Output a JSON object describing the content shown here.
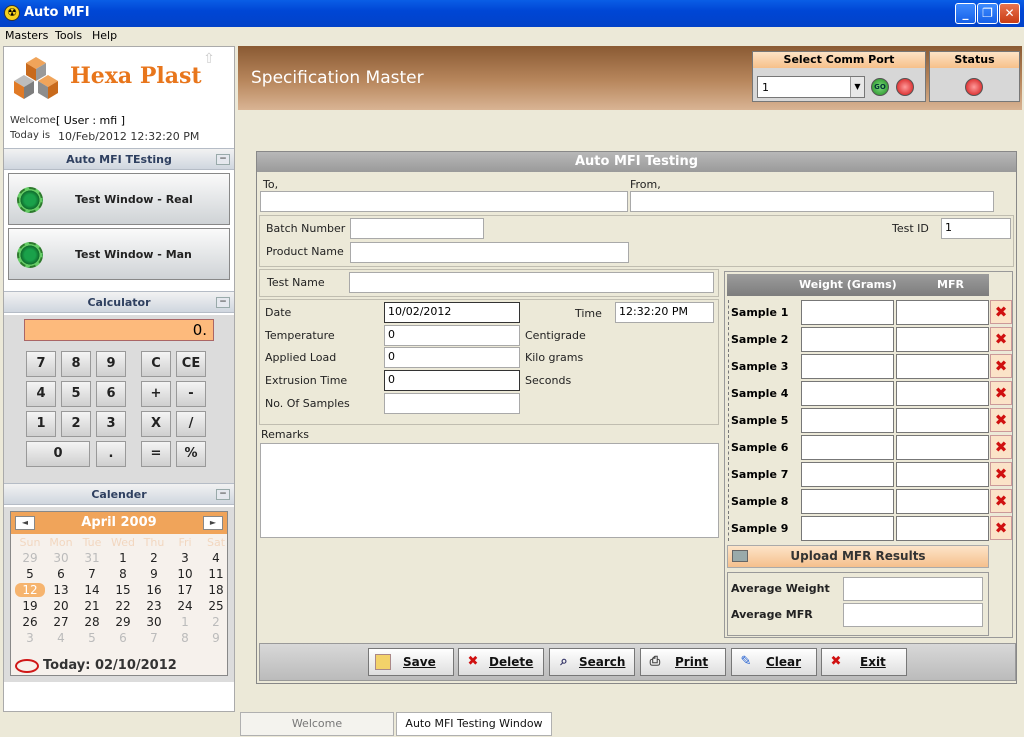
{
  "window": {
    "title": "Auto MFI"
  },
  "menu": [
    "Masters",
    "Tools",
    "Help"
  ],
  "brand": {
    "name": "Hexa Plast"
  },
  "session": {
    "welcome_label": "Welcome,",
    "user": "[ User : mfi ]",
    "today_label": "Today is",
    "today_value": "10/Feb/2012 12:32:20 PM"
  },
  "sidebar": {
    "testing_title": "Auto MFI TEsting",
    "test_real": "Test Window - Real",
    "test_man": "Test Window - Man",
    "calculator_title": "Calculator",
    "calendar_title": "Calender"
  },
  "calculator": {
    "display": "0.",
    "keys": [
      "7",
      "8",
      "9",
      "C",
      "CE",
      "4",
      "5",
      "6",
      "+",
      "-",
      "1",
      "2",
      "3",
      "X",
      "/",
      "0",
      ".",
      "=",
      "%"
    ]
  },
  "calendar": {
    "month": "April 2009",
    "prev": "◄",
    "next": "►",
    "dow": [
      "Sun",
      "Mon",
      "Tue",
      "Wed",
      "Thu",
      "Fri",
      "Sat"
    ],
    "weeks": [
      [
        "29",
        "30",
        "31",
        "1",
        "2",
        "3",
        "4"
      ],
      [
        "5",
        "6",
        "7",
        "8",
        "9",
        "10",
        "11"
      ],
      [
        "12",
        "13",
        "14",
        "15",
        "16",
        "17",
        "18"
      ],
      [
        "19",
        "20",
        "21",
        "22",
        "23",
        "24",
        "25"
      ],
      [
        "26",
        "27",
        "28",
        "29",
        "30",
        "1",
        "2"
      ],
      [
        "3",
        "4",
        "5",
        "6",
        "7",
        "8",
        "9"
      ]
    ],
    "today": "Today: 02/10/2012"
  },
  "header": {
    "title": "Specification Master",
    "comm_port_label": "Select Comm Port",
    "comm_port_value": "1",
    "go": "GO",
    "status_label": "Status"
  },
  "form": {
    "caption": "Auto MFI Testing",
    "to_label": "To,",
    "from_label": "From,",
    "to_value": "",
    "from_value": "",
    "batch_label": "Batch Number",
    "batch_value": "",
    "test_id_label": "Test ID",
    "test_id_value": "1",
    "product_label": "Product Name",
    "product_value": "",
    "test_name_label": "Test Name",
    "test_name_value": "",
    "date_label": "Date",
    "date_value": "10/02/2012",
    "time_label": "Time",
    "time_value": "12:32:20 PM",
    "temp_label": "Temperature",
    "temp_value": "0",
    "temp_unit": "Centigrade",
    "load_label": "Applied Load",
    "load_value": "0",
    "load_unit": "Kilo grams",
    "extrusion_label": "Extrusion Time",
    "extrusion_value": "0",
    "extrusion_unit": "Seconds",
    "samples_label": "No. Of Samples",
    "samples_value": "",
    "remarks_label": "Remarks",
    "remarks_value": ""
  },
  "samples": {
    "weight_header": "Weight (Grams)",
    "mfr_header": "MFR",
    "rows": [
      "Sample 1",
      "Sample 2",
      "Sample 3",
      "Sample 4",
      "Sample 5",
      "Sample 6",
      "Sample 7",
      "Sample 8",
      "Sample 9"
    ],
    "upload": "Upload MFR Results",
    "avg_weight_label": "Average Weight",
    "avg_mfr_label": "Average MFR"
  },
  "actions": {
    "save": "Save",
    "delete": "Delete",
    "search": "Search",
    "print": "Print",
    "clear": "Clear",
    "exit": "Exit"
  },
  "tabs": {
    "welcome": "Welcome",
    "testing": "Auto MFI Testing Window"
  },
  "colors": {
    "accent": "#f0a45a",
    "title_bar": "#0046d5",
    "header_brown": "#8a5a33"
  }
}
